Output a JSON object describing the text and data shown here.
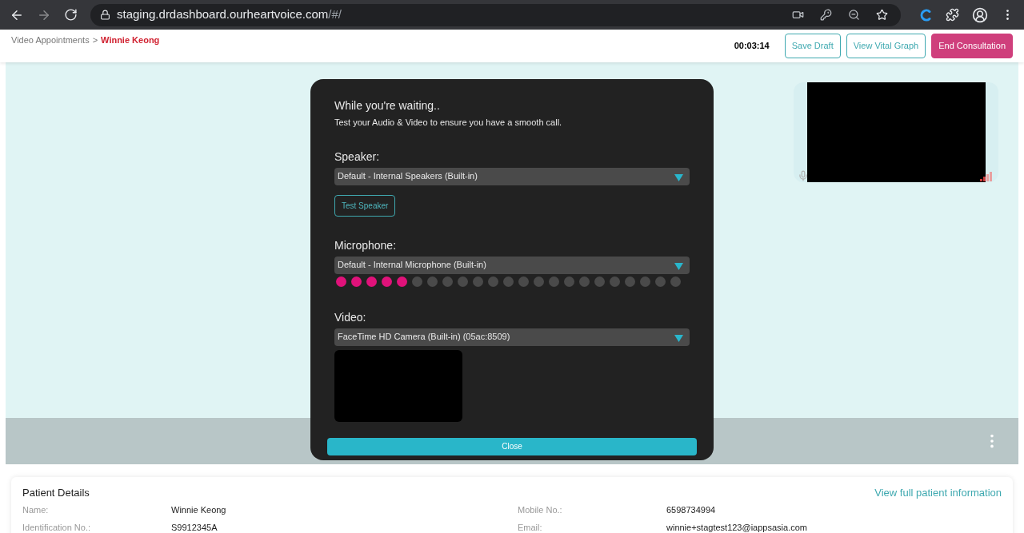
{
  "browser": {
    "url_host": "staging.drdashboard.ourheartvoice.com",
    "url_path": "/#/"
  },
  "breadcrumb": {
    "parent": "Video Appointments",
    "separator": ">",
    "current": "Winnie Keong"
  },
  "header": {
    "timer": "00:03:14",
    "buttons": [
      {
        "label": "Save Draft",
        "kind": "outline"
      },
      {
        "label": "View Vital Graph",
        "kind": "outline"
      },
      {
        "label": "End Consultation",
        "kind": "primary"
      }
    ]
  },
  "dialog": {
    "title": "While you're waiting..",
    "subtitle": "Test your Audio & Video to ensure you have a smooth call.",
    "speaker": {
      "label": "Speaker:",
      "value": "Default - Internal Speakers (Built-in)",
      "test_button": "Test Speaker"
    },
    "microphone": {
      "label": "Microphone:",
      "value": "Default - Internal Microphone (Built-in)",
      "level": 0.22
    },
    "video": {
      "label": "Video:",
      "value": "FaceTime HD Camera (Built-in) (05ac:8509)"
    },
    "close_button": "Close"
  },
  "patient": {
    "title": "Patient Details",
    "link": "View full patient information",
    "fields": [
      {
        "label": "Name:",
        "value": "Winnie Keong"
      },
      {
        "label": "Mobile No.:",
        "value": "6598734994"
      },
      {
        "label": "Identification No.:",
        "value": "S9912345A"
      },
      {
        "label": "Email:",
        "value": "winnie+stagtest123@iappsasia.com"
      }
    ]
  }
}
